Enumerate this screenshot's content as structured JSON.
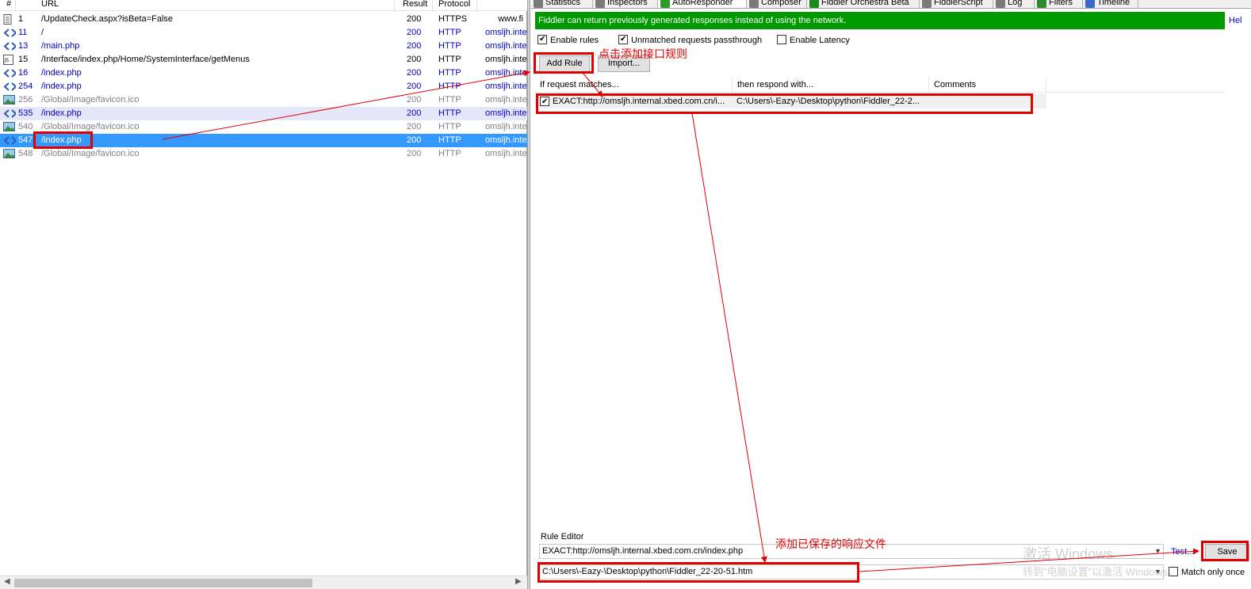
{
  "sessions": {
    "columns": [
      "#",
      "URL",
      "Result",
      "Protocol"
    ],
    "rows": [
      {
        "num": "1",
        "url": "/UpdateCheck.aspx?isBeta=False",
        "result": "200",
        "protocol": "HTTPS",
        "host": "www.fi",
        "style": "black",
        "icon": "document-icon"
      },
      {
        "num": "11",
        "url": "/",
        "result": "200",
        "protocol": "HTTP",
        "host": "omsljh.inte",
        "style": "blue",
        "icon": "code-arrows-icon"
      },
      {
        "num": "13",
        "url": "/main.php",
        "result": "200",
        "protocol": "HTTP",
        "host": "omsljh.inte",
        "style": "blue",
        "icon": "code-arrows-icon"
      },
      {
        "num": "15",
        "url": "/Interface/index.php/Home/SystemInterface/getMenus",
        "result": "200",
        "protocol": "HTTP",
        "host": "omsljh.inte",
        "style": "black",
        "icon": "json-icon"
      },
      {
        "num": "16",
        "url": "/index.php",
        "result": "200",
        "protocol": "HTTP",
        "host": "omsljh.inte",
        "style": "blue",
        "icon": "code-arrows-icon"
      },
      {
        "num": "254",
        "url": "/index.php",
        "result": "200",
        "protocol": "HTTP",
        "host": "omsljh.inte",
        "style": "blue",
        "icon": "code-arrows-icon"
      },
      {
        "num": "256",
        "url": "/Global/Image/favicon.ico",
        "result": "200",
        "protocol": "HTTP",
        "host": "omsljh.inte",
        "style": "gray",
        "icon": "image-icon"
      },
      {
        "num": "535",
        "url": "/index.php",
        "result": "200",
        "protocol": "HTTP",
        "host": "omsljh.inte",
        "style": "blue",
        "icon": "code-arrows-icon",
        "highlight": true
      },
      {
        "num": "540",
        "url": "/Global/Image/favicon.ico",
        "result": "200",
        "protocol": "HTTP",
        "host": "omsljh.inte",
        "style": "gray",
        "icon": "image-icon"
      },
      {
        "num": "547",
        "url": "/index.php",
        "result": "200",
        "protocol": "HTTP",
        "host": "omsljh.inte",
        "style": "blue",
        "icon": "code-arrows-icon",
        "selected": true
      },
      {
        "num": "548",
        "url": "/Global/Image/favicon.ico",
        "result": "200",
        "protocol": "HTTP",
        "host": "omsljh.inte",
        "style": "gray",
        "icon": "image-icon"
      }
    ]
  },
  "tabs": [
    {
      "label": "Statistics",
      "icon": "stopwatch-icon"
    },
    {
      "label": "Inspectors",
      "icon": "magnifier-icon"
    },
    {
      "label": "AutoResponder",
      "icon": "lightning-icon",
      "active": true
    },
    {
      "label": "Composer",
      "icon": "pencil-icon"
    },
    {
      "label": "Fiddler Orchestra Beta",
      "icon": "fo-icon"
    },
    {
      "label": "FiddlerScript",
      "icon": "script-icon"
    },
    {
      "label": "Log",
      "icon": "log-icon"
    },
    {
      "label": "Filters",
      "icon": "checkbox-icon"
    },
    {
      "label": "Timeline",
      "icon": "timeline-icon"
    }
  ],
  "autoresponder": {
    "banner": "Fiddler can return previously generated responses instead of using the network.",
    "help": "Hel",
    "enable_rules": "Enable rules",
    "unmatched": "Unmatched requests passthrough",
    "enable_latency": "Enable Latency",
    "enable_rules_checked": true,
    "unmatched_checked": true,
    "enable_latency_checked": false,
    "add_rule": "Add Rule",
    "import": "Import...",
    "columns": {
      "match": "If request matches...",
      "respond": "then respond with...",
      "comments": "Comments"
    },
    "rule": {
      "match": "EXACT:http://omsljh.internal.xbed.com.cn/i...",
      "respond": "C:\\Users\\-Eazy-\\Desktop\\python\\Fiddler_22-2...",
      "checked": true
    },
    "editor": {
      "title": "Rule Editor",
      "match_value": "EXACT:http://omsljh.internal.xbed.com.cn/index.php",
      "response_value": "C:\\Users\\-Eazy-\\Desktop\\python\\Fiddler_22-20-51.htm",
      "test": "Test...",
      "save": "Save",
      "match_only_once": "Match only once"
    }
  },
  "annotations": {
    "add_rule_note": "点击添加接口规则",
    "response_file_note": "添加已保存的响应文件",
    "color": "#e00000"
  },
  "watermark": {
    "line1": "激活 Windows",
    "line2": "转到\"电脑设置\"以激活 Windows。"
  }
}
